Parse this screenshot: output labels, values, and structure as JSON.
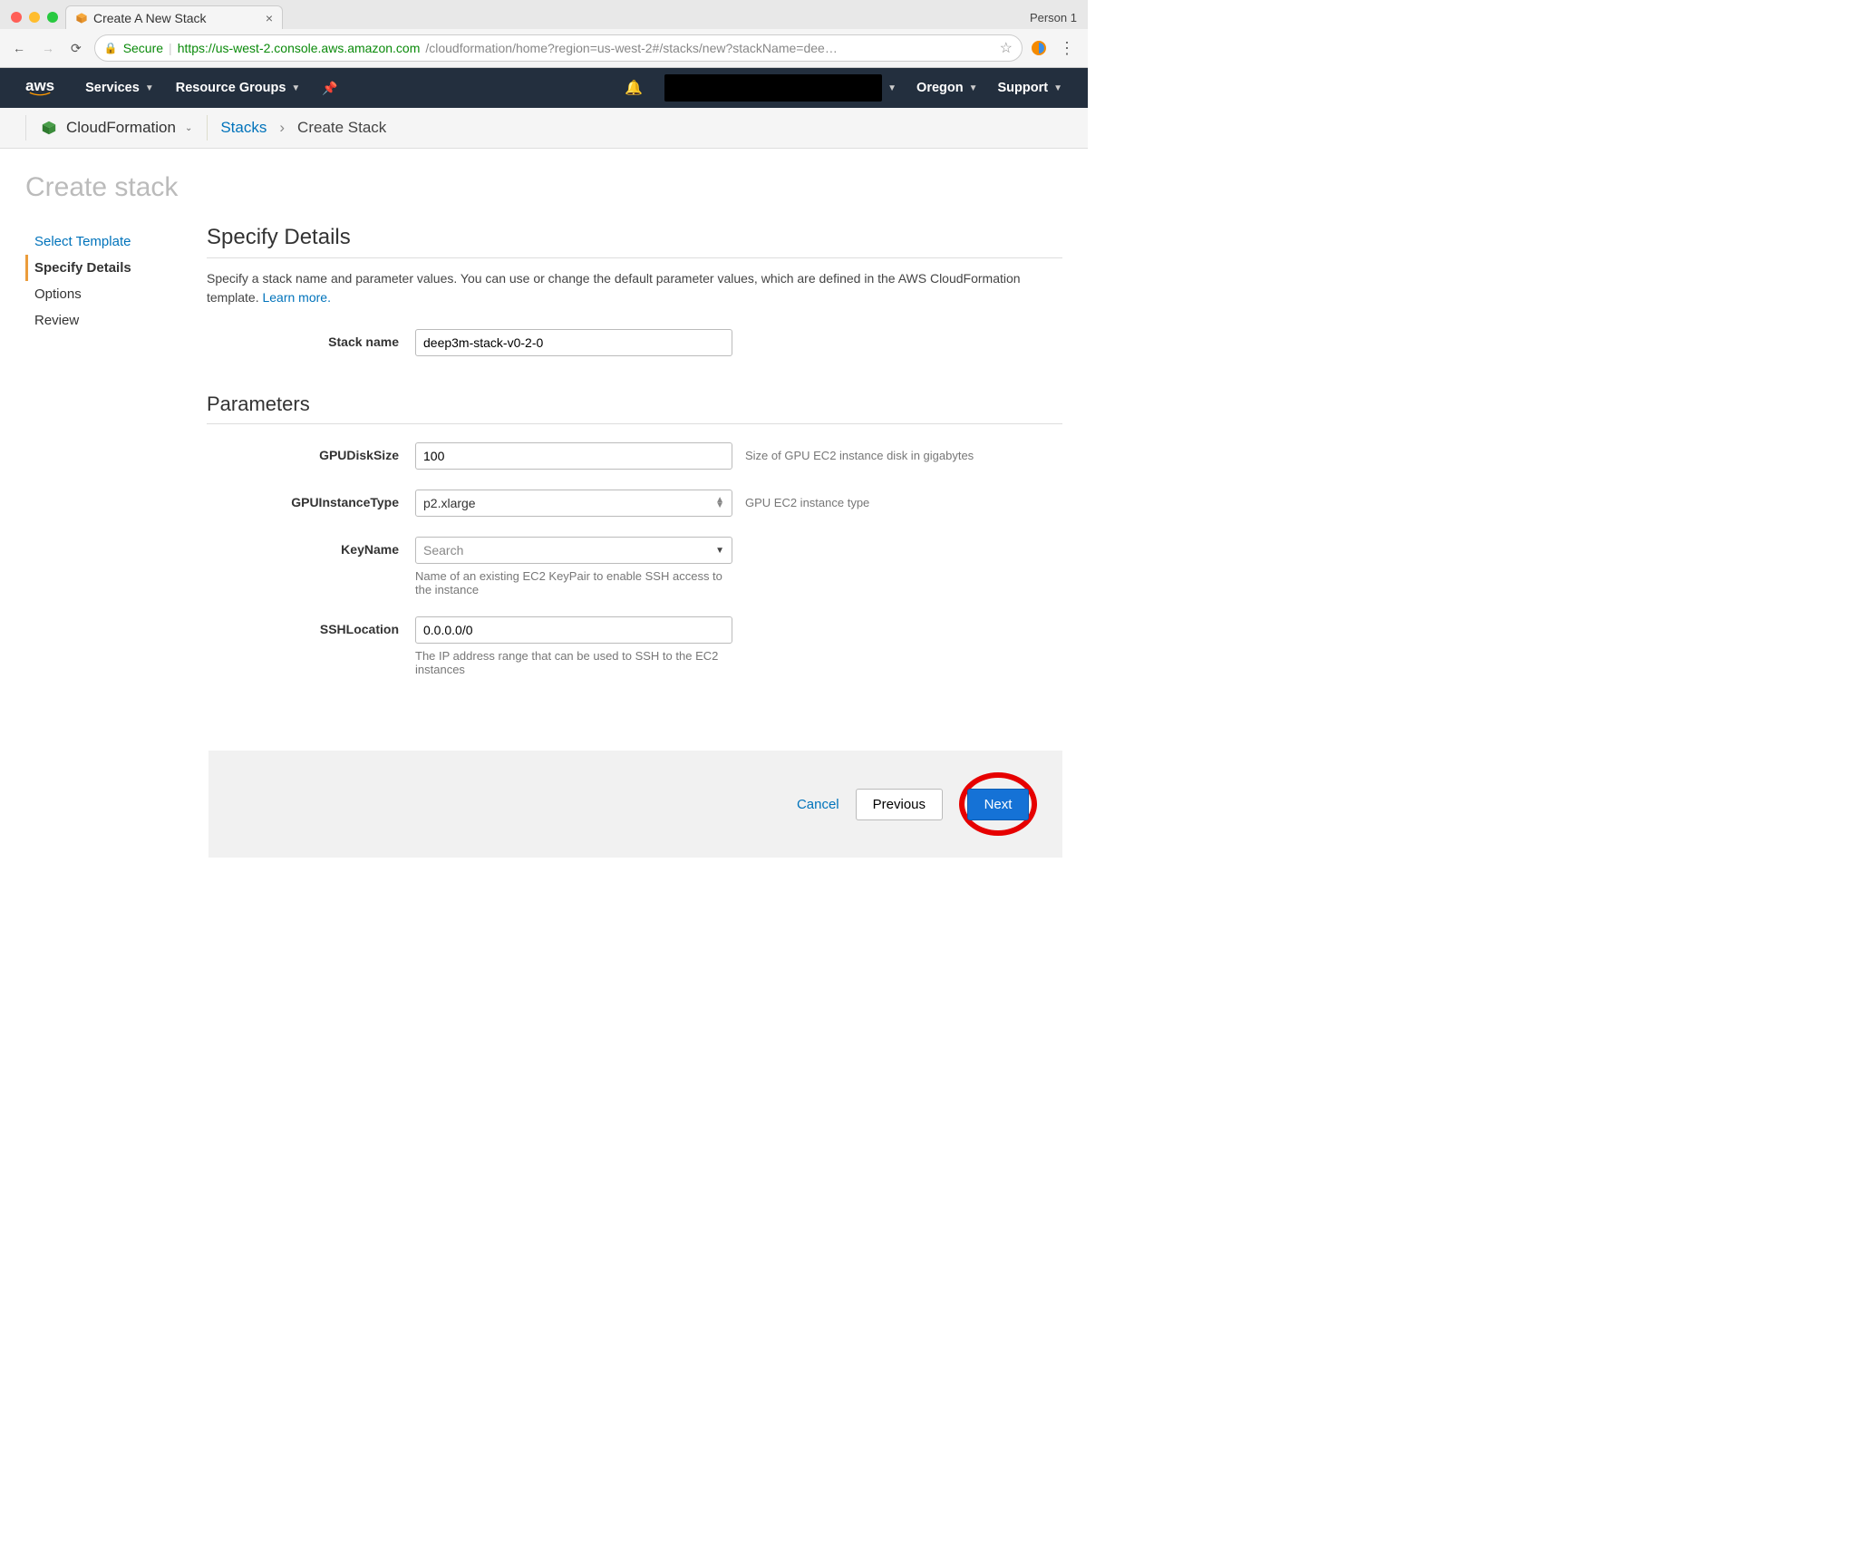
{
  "browser": {
    "tab_title": "Create A New Stack",
    "person_label": "Person 1",
    "secure_label": "Secure",
    "url_host": "https://us-west-2.console.aws.amazon.com",
    "url_path": "/cloudformation/home?region=us-west-2#/stacks/new?stackName=dee…"
  },
  "aws_nav": {
    "services": "Services",
    "resource_groups": "Resource Groups",
    "region": "Oregon",
    "support": "Support"
  },
  "svc_bar": {
    "service": "CloudFormation",
    "crumb1": "Stacks",
    "crumb2": "Create Stack"
  },
  "page": {
    "title": "Create stack"
  },
  "wizard": {
    "steps": [
      "Select Template",
      "Specify Details",
      "Options",
      "Review"
    ],
    "active_index": 1
  },
  "sections": {
    "details": {
      "heading": "Specify Details",
      "desc_pre": "Specify a stack name and parameter values. You can use or change the default parameter values, which are defined in the AWS CloudFormation template. ",
      "learn_more": "Learn more."
    },
    "parameters": {
      "heading": "Parameters"
    }
  },
  "form": {
    "stack_name": {
      "label": "Stack name",
      "value": "deep3m-stack-v0-2-0"
    },
    "gpu_disk": {
      "label": "GPUDiskSize",
      "value": "100",
      "help": "Size of GPU EC2 instance disk in gigabytes"
    },
    "gpu_type": {
      "label": "GPUInstanceType",
      "value": "p2.xlarge",
      "help": "GPU EC2 instance type"
    },
    "key_name": {
      "label": "KeyName",
      "placeholder": "Search",
      "help": "Name of an existing EC2 KeyPair to enable SSH access to the instance"
    },
    "ssh_loc": {
      "label": "SSHLocation",
      "value": "0.0.0.0/0",
      "help": "The IP address range that can be used to SSH to the EC2 instances"
    }
  },
  "footer": {
    "cancel": "Cancel",
    "previous": "Previous",
    "next": "Next"
  }
}
